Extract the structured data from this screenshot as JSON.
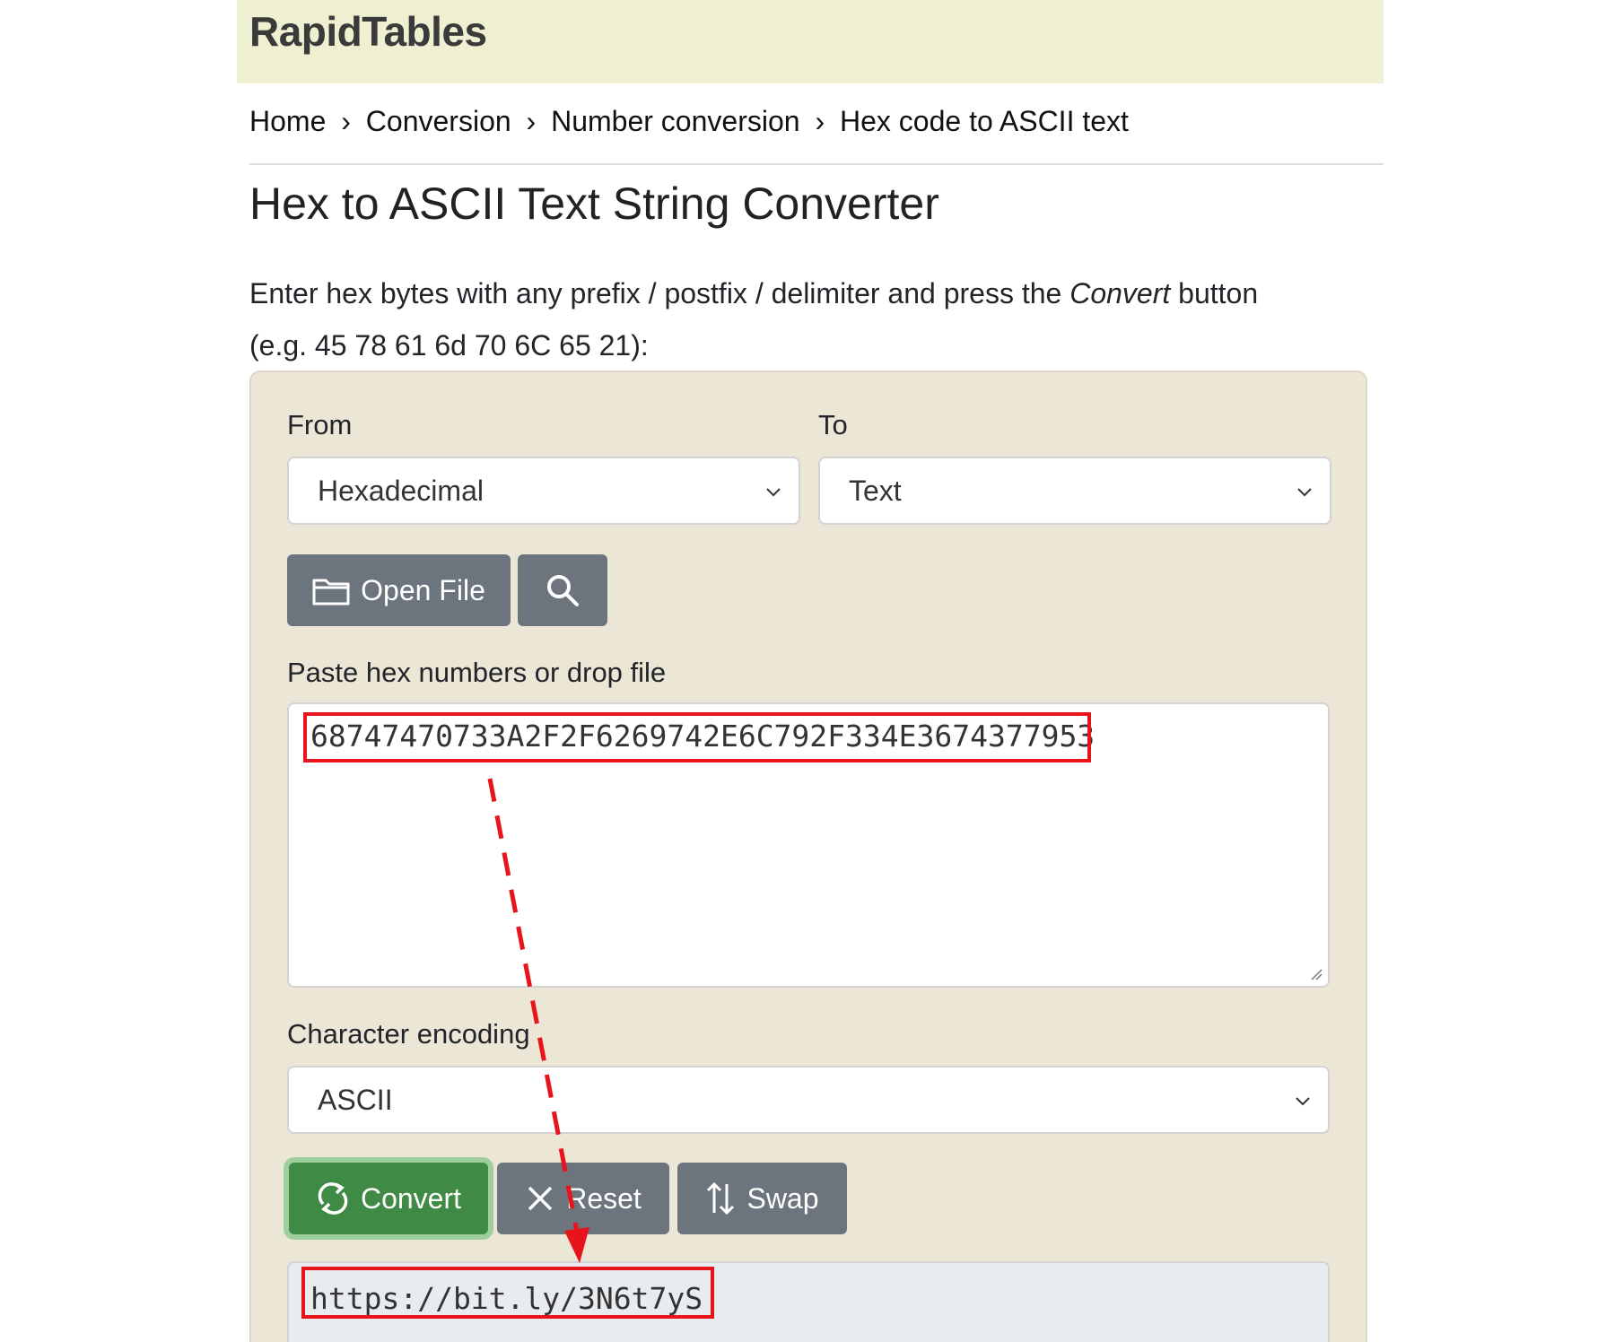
{
  "header": {
    "logo": "RapidTables"
  },
  "breadcrumb": {
    "items": [
      "Home",
      "Conversion",
      "Number conversion",
      "Hex code to ASCII text"
    ],
    "separator": "›"
  },
  "page": {
    "title": "Hex to ASCII Text String Converter",
    "intro_before": "Enter hex bytes with any prefix / postfix / delimiter and press the ",
    "intro_em": "Convert",
    "intro_after": " button",
    "intro_example": "(e.g. 45 78 61 6d 70 6C 65 21):"
  },
  "converter": {
    "from_label": "From",
    "from_value": "Hexadecimal",
    "to_label": "To",
    "to_value": "Text",
    "open_file_label": "Open File",
    "input_label": "Paste hex numbers or drop file",
    "input_value": "68747470733A2F2F6269742E6C792F334E3674377953",
    "encoding_label": "Character encoding",
    "encoding_value": "ASCII",
    "convert_label": "Convert",
    "reset_label": "Reset",
    "swap_label": "Swap",
    "output_value": "https://bit.ly/3N6t7yS"
  },
  "colors": {
    "header_bg": "#eff0d1",
    "panel_bg": "#ece6d6",
    "button_gray": "#6c757d",
    "button_green": "#3f8a44",
    "highlight_red": "#e8141b"
  },
  "icons": {
    "open_file": "folder-icon",
    "search": "search-icon",
    "convert": "refresh-icon",
    "reset": "close-icon",
    "swap": "swap-arrows-icon",
    "select": "chevron-down-icon"
  }
}
